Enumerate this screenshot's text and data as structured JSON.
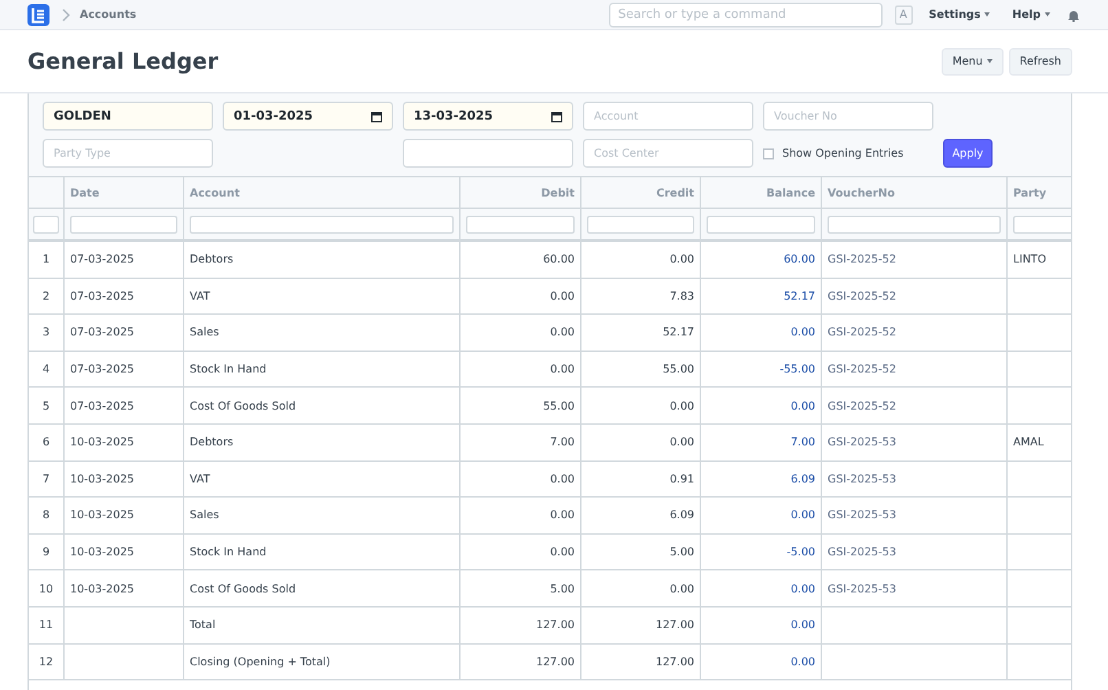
{
  "navbar": {
    "breadcrumb": "Accounts",
    "search": {
      "placeholder": "Search or type a command"
    },
    "avatar": "A",
    "menus": [
      "Settings",
      "Help"
    ]
  },
  "page": {
    "title": "General Ledger",
    "buttons": [
      {
        "label": "Menu",
        "dropdown": true
      },
      {
        "label": "Refresh",
        "dropdown": false
      }
    ]
  },
  "filters": [
    {
      "kind": "text",
      "value": "GOLDEN"
    },
    {
      "kind": "date",
      "value": "01-03-2025"
    },
    {
      "kind": "date",
      "value": "13-03-2025"
    },
    {
      "kind": "text",
      "placeholder": "Account"
    },
    {
      "kind": "text",
      "placeholder": "Voucher No"
    },
    {
      "kind": "text",
      "placeholder": "Party Type"
    },
    {
      "kind": "text"
    },
    {
      "kind": "text",
      "placeholder": "Cost Center"
    },
    {
      "kind": "checkbox",
      "label": "Show Opening Entries",
      "checked": false
    },
    {
      "kind": "button",
      "label": "Apply"
    }
  ],
  "table": {
    "columns": [
      "Date",
      "Account",
      "Debit",
      "Credit",
      "Balance",
      "VoucherNo",
      "Party"
    ],
    "rows": [
      {
        "n": "1",
        "date": "07-03-2025",
        "account": "Debtors",
        "debit": "60.00",
        "credit": "0.00",
        "balance": "60.00",
        "voucher": "GSI-2025-52",
        "party": "LINTO"
      },
      {
        "n": "2",
        "date": "07-03-2025",
        "account": "VAT",
        "debit": "0.00",
        "credit": "7.83",
        "balance": "52.17",
        "voucher": "GSI-2025-52"
      },
      {
        "n": "3",
        "date": "07-03-2025",
        "account": "Sales",
        "debit": "0.00",
        "credit": "52.17",
        "balance": "0.00",
        "voucher": "GSI-2025-52"
      },
      {
        "n": "4",
        "date": "07-03-2025",
        "account": "Stock In Hand",
        "debit": "0.00",
        "credit": "55.00",
        "balance": "-55.00",
        "voucher": "GSI-2025-52"
      },
      {
        "n": "5",
        "date": "07-03-2025",
        "account": "Cost Of Goods Sold",
        "debit": "55.00",
        "credit": "0.00",
        "balance": "0.00",
        "voucher": "GSI-2025-52"
      },
      {
        "n": "6",
        "date": "10-03-2025",
        "account": "Debtors",
        "debit": "7.00",
        "credit": "0.00",
        "balance": "7.00",
        "voucher": "GSI-2025-53",
        "party": "AMAL"
      },
      {
        "n": "7",
        "date": "10-03-2025",
        "account": "VAT",
        "debit": "0.00",
        "credit": "0.91",
        "balance": "6.09",
        "voucher": "GSI-2025-53"
      },
      {
        "n": "8",
        "date": "10-03-2025",
        "account": "Sales",
        "debit": "0.00",
        "credit": "6.09",
        "balance": "0.00",
        "voucher": "GSI-2025-53"
      },
      {
        "n": "9",
        "date": "10-03-2025",
        "account": "Stock In Hand",
        "debit": "0.00",
        "credit": "5.00",
        "balance": "-5.00",
        "voucher": "GSI-2025-53"
      },
      {
        "n": "10",
        "date": "10-03-2025",
        "account": "Cost Of Goods Sold",
        "debit": "5.00",
        "credit": "0.00",
        "balance": "0.00",
        "voucher": "GSI-2025-53"
      },
      {
        "n": "11",
        "account": "Total",
        "debit": "127.00",
        "credit": "127.00",
        "balance": "0.00"
      },
      {
        "n": "12",
        "account": "Closing (Opening + Total)",
        "debit": "127.00",
        "credit": "127.00",
        "balance": "0.00"
      }
    ]
  }
}
